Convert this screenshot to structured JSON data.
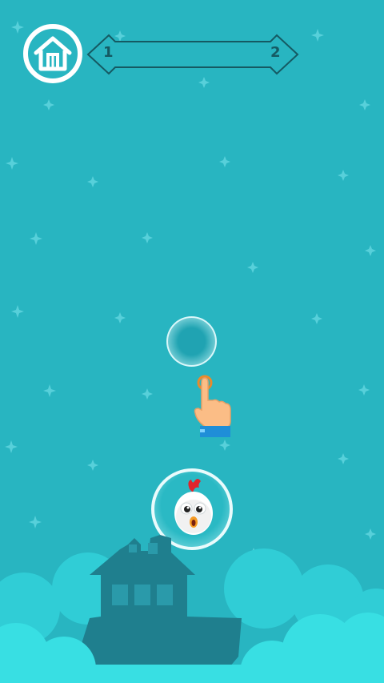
{
  "hud": {
    "home_icon": "house-icon",
    "level_current": "1",
    "level_next": "2",
    "progress": 0
  },
  "tutorial": {
    "hint_icon": "tap-hand-icon"
  },
  "player": {
    "character": "chicken"
  },
  "colors": {
    "sky": "#28b5c1",
    "clouds": "#33d1d8",
    "house_silhouette": "#1f7f8e",
    "accent_white": "#ffffff"
  }
}
